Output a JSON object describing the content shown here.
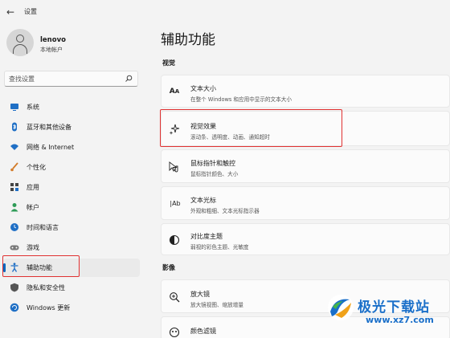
{
  "app": {
    "title": "设置",
    "back_icon": "back-arrow-icon"
  },
  "user": {
    "name": "lenovo",
    "account_type": "本地帐户"
  },
  "search": {
    "placeholder": "查找设置"
  },
  "sidebar": {
    "items": [
      {
        "label": "系统",
        "icon": "monitor-icon",
        "color": "#1f6fc5"
      },
      {
        "label": "蓝牙和其他设备",
        "icon": "bluetooth-icon",
        "color": "#1f6fc5"
      },
      {
        "label": "网络 & Internet",
        "icon": "wifi-icon",
        "color": "#1f6fc5"
      },
      {
        "label": "个性化",
        "icon": "brush-icon",
        "color": "#d27b2a"
      },
      {
        "label": "应用",
        "icon": "apps-icon",
        "color": "#444444"
      },
      {
        "label": "帐户",
        "icon": "person-icon",
        "color": "#2e9b57"
      },
      {
        "label": "时间和语言",
        "icon": "globe-clock-icon",
        "color": "#1f6fc5"
      },
      {
        "label": "游戏",
        "icon": "gamepad-icon",
        "color": "#777777"
      },
      {
        "label": "辅助功能",
        "icon": "accessibility-icon",
        "color": "#1f6fc5",
        "active": true
      },
      {
        "label": "隐私和安全性",
        "icon": "shield-icon",
        "color": "#555555"
      },
      {
        "label": "Windows 更新",
        "icon": "update-icon",
        "color": "#1f6fc5"
      }
    ]
  },
  "main": {
    "title": "辅助功能",
    "sections": [
      {
        "label": "视觉"
      },
      {
        "label": "影像"
      }
    ],
    "cards": [
      {
        "title": "文本大小",
        "desc": "在整个 Windows 和应用中显示的文本大小",
        "icon": "text-size-icon"
      },
      {
        "title": "视觉效果",
        "desc": "滚动条、透明度、动画、通知超时",
        "icon": "sparkle-icon"
      },
      {
        "title": "鼠标指针和触控",
        "desc": "鼠标指针颜色、大小",
        "icon": "mouse-pointer-icon"
      },
      {
        "title": "文本光标",
        "desc": "外观和粗细、文本光标指示器",
        "icon": "text-cursor-icon"
      },
      {
        "title": "对比度主题",
        "desc": "弱视的彩色主题、光敏度",
        "icon": "contrast-icon"
      },
      {
        "title": "放大镜",
        "desc": "放大镜视图、缩放增量",
        "icon": "magnifier-icon"
      },
      {
        "title": "颜色滤镜",
        "desc": "",
        "icon": "color-filter-icon"
      }
    ]
  },
  "watermark": {
    "brand": "极光下载站",
    "url": "www.xz7.com"
  }
}
